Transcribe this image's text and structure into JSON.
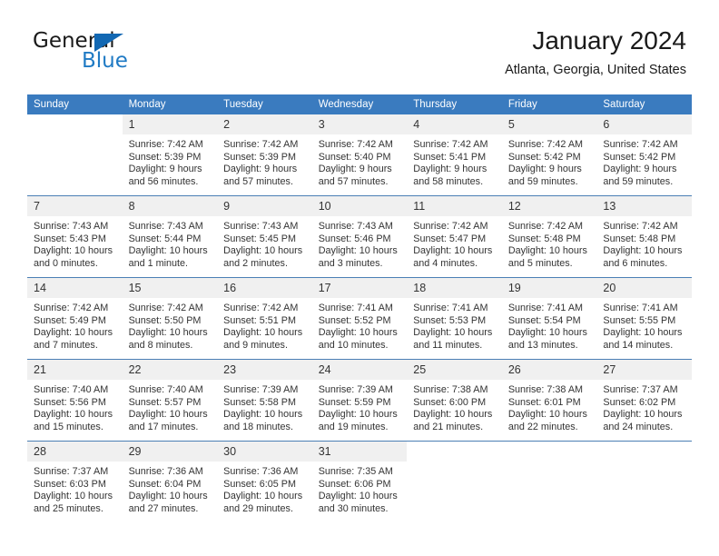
{
  "brand": {
    "name_part1": "General",
    "name_part2": "Blue",
    "triangle_color": "#1268b3",
    "blue_color": "#1f7ac4"
  },
  "header": {
    "title": "January 2024",
    "subtitle": "Atlanta, Georgia, United States"
  },
  "theme": {
    "header_row_bg": "#3a7bbf",
    "daynum_bg": "#f0f0f0",
    "row_border": "#4b7fb5",
    "text": "#333333"
  },
  "weekdays": [
    "Sunday",
    "Monday",
    "Tuesday",
    "Wednesday",
    "Thursday",
    "Friday",
    "Saturday"
  ],
  "weeks": [
    [
      {
        "day": "",
        "lines": [
          "",
          "",
          "",
          ""
        ]
      },
      {
        "day": "1",
        "lines": [
          "Sunrise: 7:42 AM",
          "Sunset: 5:39 PM",
          "Daylight: 9 hours",
          "and 56 minutes."
        ]
      },
      {
        "day": "2",
        "lines": [
          "Sunrise: 7:42 AM",
          "Sunset: 5:39 PM",
          "Daylight: 9 hours",
          "and 57 minutes."
        ]
      },
      {
        "day": "3",
        "lines": [
          "Sunrise: 7:42 AM",
          "Sunset: 5:40 PM",
          "Daylight: 9 hours",
          "and 57 minutes."
        ]
      },
      {
        "day": "4",
        "lines": [
          "Sunrise: 7:42 AM",
          "Sunset: 5:41 PM",
          "Daylight: 9 hours",
          "and 58 minutes."
        ]
      },
      {
        "day": "5",
        "lines": [
          "Sunrise: 7:42 AM",
          "Sunset: 5:42 PM",
          "Daylight: 9 hours",
          "and 59 minutes."
        ]
      },
      {
        "day": "6",
        "lines": [
          "Sunrise: 7:42 AM",
          "Sunset: 5:42 PM",
          "Daylight: 9 hours",
          "and 59 minutes."
        ]
      }
    ],
    [
      {
        "day": "7",
        "lines": [
          "Sunrise: 7:43 AM",
          "Sunset: 5:43 PM",
          "Daylight: 10 hours",
          "and 0 minutes."
        ]
      },
      {
        "day": "8",
        "lines": [
          "Sunrise: 7:43 AM",
          "Sunset: 5:44 PM",
          "Daylight: 10 hours",
          "and 1 minute."
        ]
      },
      {
        "day": "9",
        "lines": [
          "Sunrise: 7:43 AM",
          "Sunset: 5:45 PM",
          "Daylight: 10 hours",
          "and 2 minutes."
        ]
      },
      {
        "day": "10",
        "lines": [
          "Sunrise: 7:43 AM",
          "Sunset: 5:46 PM",
          "Daylight: 10 hours",
          "and 3 minutes."
        ]
      },
      {
        "day": "11",
        "lines": [
          "Sunrise: 7:42 AM",
          "Sunset: 5:47 PM",
          "Daylight: 10 hours",
          "and 4 minutes."
        ]
      },
      {
        "day": "12",
        "lines": [
          "Sunrise: 7:42 AM",
          "Sunset: 5:48 PM",
          "Daylight: 10 hours",
          "and 5 minutes."
        ]
      },
      {
        "day": "13",
        "lines": [
          "Sunrise: 7:42 AM",
          "Sunset: 5:48 PM",
          "Daylight: 10 hours",
          "and 6 minutes."
        ]
      }
    ],
    [
      {
        "day": "14",
        "lines": [
          "Sunrise: 7:42 AM",
          "Sunset: 5:49 PM",
          "Daylight: 10 hours",
          "and 7 minutes."
        ]
      },
      {
        "day": "15",
        "lines": [
          "Sunrise: 7:42 AM",
          "Sunset: 5:50 PM",
          "Daylight: 10 hours",
          "and 8 minutes."
        ]
      },
      {
        "day": "16",
        "lines": [
          "Sunrise: 7:42 AM",
          "Sunset: 5:51 PM",
          "Daylight: 10 hours",
          "and 9 minutes."
        ]
      },
      {
        "day": "17",
        "lines": [
          "Sunrise: 7:41 AM",
          "Sunset: 5:52 PM",
          "Daylight: 10 hours",
          "and 10 minutes."
        ]
      },
      {
        "day": "18",
        "lines": [
          "Sunrise: 7:41 AM",
          "Sunset: 5:53 PM",
          "Daylight: 10 hours",
          "and 11 minutes."
        ]
      },
      {
        "day": "19",
        "lines": [
          "Sunrise: 7:41 AM",
          "Sunset: 5:54 PM",
          "Daylight: 10 hours",
          "and 13 minutes."
        ]
      },
      {
        "day": "20",
        "lines": [
          "Sunrise: 7:41 AM",
          "Sunset: 5:55 PM",
          "Daylight: 10 hours",
          "and 14 minutes."
        ]
      }
    ],
    [
      {
        "day": "21",
        "lines": [
          "Sunrise: 7:40 AM",
          "Sunset: 5:56 PM",
          "Daylight: 10 hours",
          "and 15 minutes."
        ]
      },
      {
        "day": "22",
        "lines": [
          "Sunrise: 7:40 AM",
          "Sunset: 5:57 PM",
          "Daylight: 10 hours",
          "and 17 minutes."
        ]
      },
      {
        "day": "23",
        "lines": [
          "Sunrise: 7:39 AM",
          "Sunset: 5:58 PM",
          "Daylight: 10 hours",
          "and 18 minutes."
        ]
      },
      {
        "day": "24",
        "lines": [
          "Sunrise: 7:39 AM",
          "Sunset: 5:59 PM",
          "Daylight: 10 hours",
          "and 19 minutes."
        ]
      },
      {
        "day": "25",
        "lines": [
          "Sunrise: 7:38 AM",
          "Sunset: 6:00 PM",
          "Daylight: 10 hours",
          "and 21 minutes."
        ]
      },
      {
        "day": "26",
        "lines": [
          "Sunrise: 7:38 AM",
          "Sunset: 6:01 PM",
          "Daylight: 10 hours",
          "and 22 minutes."
        ]
      },
      {
        "day": "27",
        "lines": [
          "Sunrise: 7:37 AM",
          "Sunset: 6:02 PM",
          "Daylight: 10 hours",
          "and 24 minutes."
        ]
      }
    ],
    [
      {
        "day": "28",
        "lines": [
          "Sunrise: 7:37 AM",
          "Sunset: 6:03 PM",
          "Daylight: 10 hours",
          "and 25 minutes."
        ]
      },
      {
        "day": "29",
        "lines": [
          "Sunrise: 7:36 AM",
          "Sunset: 6:04 PM",
          "Daylight: 10 hours",
          "and 27 minutes."
        ]
      },
      {
        "day": "30",
        "lines": [
          "Sunrise: 7:36 AM",
          "Sunset: 6:05 PM",
          "Daylight: 10 hours",
          "and 29 minutes."
        ]
      },
      {
        "day": "31",
        "lines": [
          "Sunrise: 7:35 AM",
          "Sunset: 6:06 PM",
          "Daylight: 10 hours",
          "and 30 minutes."
        ]
      },
      {
        "day": "",
        "lines": [
          "",
          "",
          "",
          ""
        ]
      },
      {
        "day": "",
        "lines": [
          "",
          "",
          "",
          ""
        ]
      },
      {
        "day": "",
        "lines": [
          "",
          "",
          "",
          ""
        ]
      }
    ]
  ]
}
